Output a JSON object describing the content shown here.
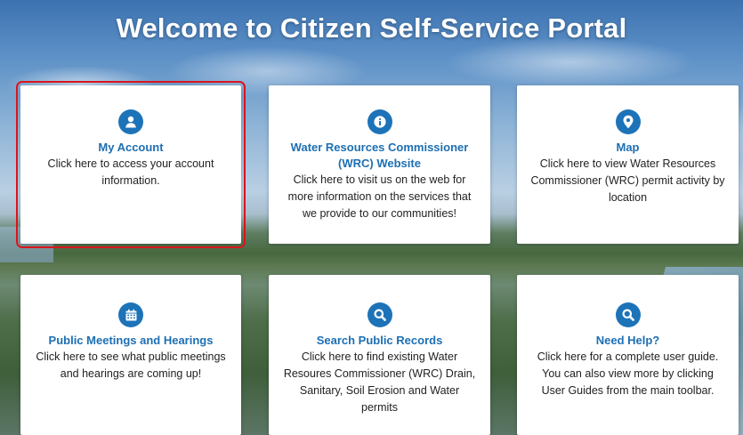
{
  "header": {
    "title": "Welcome to Citizen Self-Service Portal"
  },
  "colors": {
    "accent": "#1d73b8",
    "title_blue": "#1d6fb3",
    "selection": "#d9151d"
  },
  "cards": [
    {
      "icon": "user-icon",
      "title": "My Account",
      "description": "Click here to access your account information."
    },
    {
      "icon": "info-icon",
      "title": "Water Resources Commissioner (WRC) Website",
      "description": "Click here to visit us on the web for more information on the services that we provide to our communities!"
    },
    {
      "icon": "map-pin-icon",
      "title": "Map",
      "description": "Click here to view Water Resources Commissioner (WRC) permit activity by location"
    },
    {
      "icon": "calendar-icon",
      "title": "Public Meetings and Hearings",
      "description": "Click here to see what public meetings and hearings are coming up!"
    },
    {
      "icon": "search-icon",
      "title": "Search Public Records",
      "description": "Click here to find existing Water Resoures Commissioner (WRC) Drain, Sanitary, Soil Erosion and Water permits"
    },
    {
      "icon": "search-icon",
      "title": "Need Help?",
      "description": "Click here for a complete user guide. You can also view more by clicking User Guides from the main toolbar."
    }
  ]
}
